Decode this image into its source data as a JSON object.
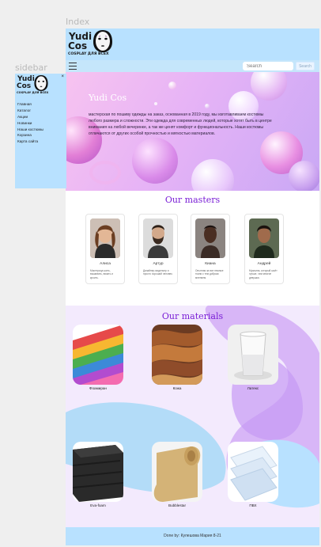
{
  "frames": {
    "index_label": "Index",
    "sidebar_label": "sidebar"
  },
  "brand": {
    "line1": "Yudi",
    "line2": "Cos",
    "tagline": "COSPLAY ДЛЯ ВСЕХ"
  },
  "navbar": {
    "search_placeholder": "Search",
    "search_button": "Search"
  },
  "hero": {
    "title": "Yudi Cos",
    "text": "мастерская по пошиву одежды на заказ, основанная в 2019 году, мы изготавливаем костюмы любого размера и сложности. Эти одежда для современных людей, которые хотят быть в центре внимания на любой вечеринке, а так же ценят комфорт и функциональность. Наши костюмы отличаются от других особой прочностью и мягкостью материалов."
  },
  "masters": {
    "title": "Our masters",
    "cards": [
      {
        "name": "Алиса",
        "desc": "Мастерица шить, вышивать, вязать и кроить."
      },
      {
        "name": "Артур",
        "desc": "Дизайнер-модельер и просто хороший человек."
      },
      {
        "name": "Киана",
        "desc": "Опытная за все нежные ткани с тем добрым мнением."
      },
      {
        "name": "Андрей",
        "desc": "Мужчина, который шьёт лучше, чем многие девушки."
      }
    ]
  },
  "materials": {
    "title": "Our materials",
    "items": [
      {
        "label": "Фоамиран",
        "icon": "foamiran-sheets-icon"
      },
      {
        "label": "Кожа",
        "icon": "leather-pieces-icon"
      },
      {
        "label": "Латекс",
        "icon": "latex-cup-icon"
      },
      {
        "label": "Eva-foam",
        "icon": "eva-foam-sheets-icon"
      },
      {
        "label": "Bubblestar",
        "icon": "bubblestar-roll-icon"
      },
      {
        "label": "ПВХ",
        "icon": "pvc-sheets-icon"
      }
    ]
  },
  "footer": {
    "text": "Done by: Кулешова Мария 8-21"
  },
  "sidebar": {
    "close": "×",
    "items": [
      "Главная",
      "Каталог",
      "Акции",
      "Новинки",
      "Наши костюмы",
      "Корзина",
      "Карта сайта"
    ]
  },
  "colors": {
    "header_bg": "#b8e1ff",
    "accent_purple": "#7a1fd6",
    "materials_bg": "#f3eafd",
    "hero_gradient": "#e6b3f6"
  }
}
